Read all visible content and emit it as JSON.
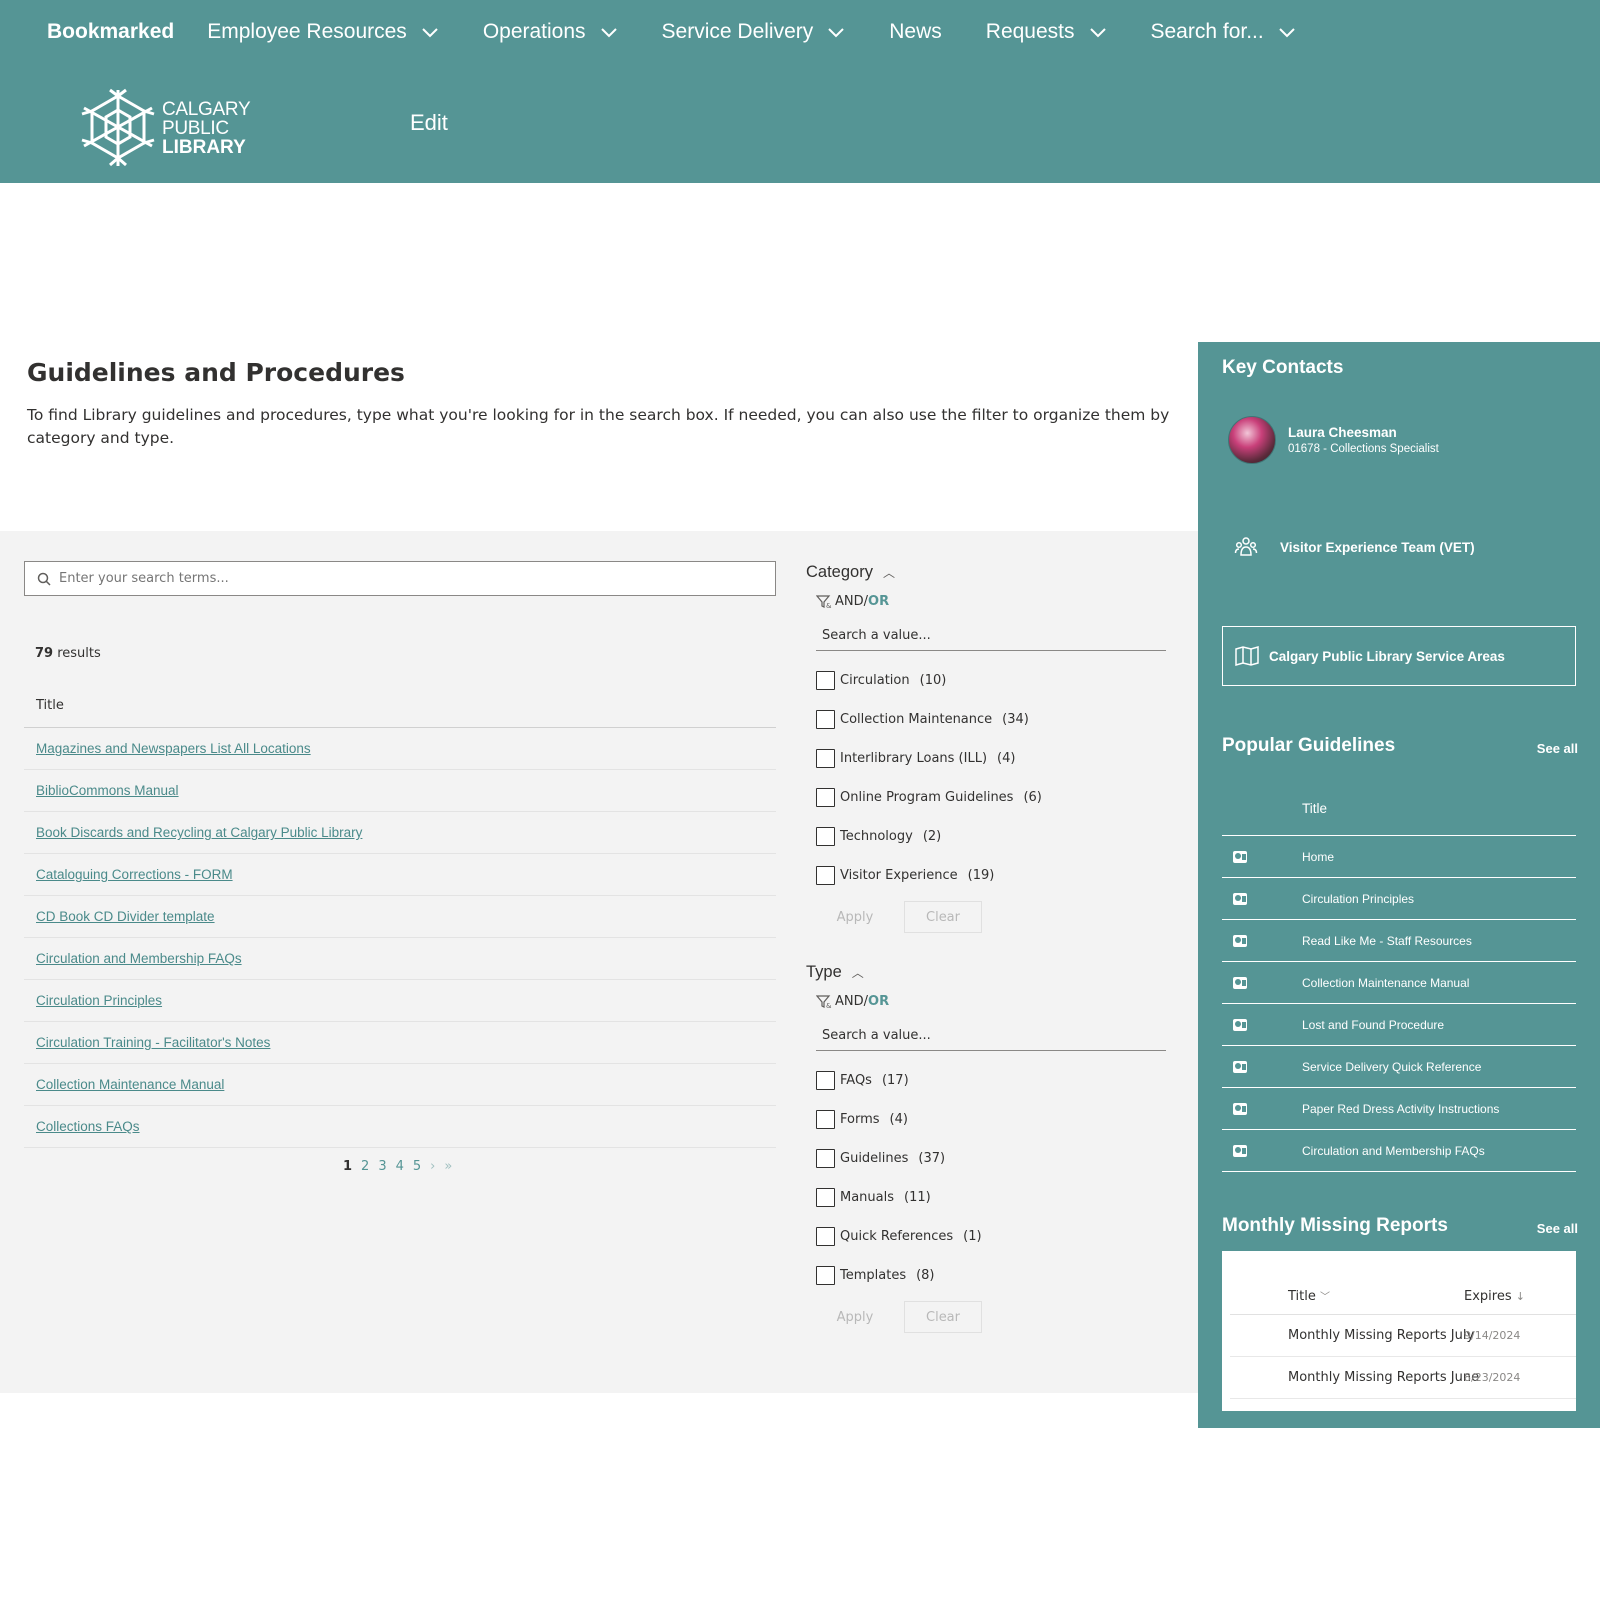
{
  "nav": {
    "brand": "Bookmarked",
    "items": [
      {
        "label": "Employee Resources",
        "dropdown": true
      },
      {
        "label": "Operations",
        "dropdown": true
      },
      {
        "label": "Service Delivery",
        "dropdown": true
      },
      {
        "label": "News",
        "dropdown": false
      },
      {
        "label": "Requests",
        "dropdown": true
      },
      {
        "label": "Search for...",
        "dropdown": true
      }
    ]
  },
  "header": {
    "logo_line1": "CALGARY",
    "logo_line2": "PUBLIC",
    "logo_line3": "LIBRARY",
    "edit_label": "Edit"
  },
  "page": {
    "title": "Guidelines and Procedures",
    "description": "To find Library guidelines and procedures, type what you're looking for in the search box. If needed, you can also use the filter to organize them by category and type."
  },
  "search": {
    "placeholder": "Enter your search terms...",
    "results_count": "79",
    "results_label": " results",
    "column_title": "Title",
    "results": [
      "Magazines and Newspapers List All Locations",
      "BiblioCommons Manual",
      "Book Discards and Recycling at Calgary Public Library",
      "Cataloguing Corrections - FORM",
      "CD Book CD Divider template",
      "Circulation and Membership FAQs",
      "Circulation Principles",
      "Circulation Training - Facilitator's Notes",
      "Collection Maintenance Manual",
      "Collections FAQs"
    ],
    "pager": {
      "pages": [
        "1",
        "2",
        "3",
        "4",
        "5"
      ],
      "current": "1",
      "next": "›",
      "last": "»"
    }
  },
  "filters": {
    "andor_and": "AND/",
    "andor_or": "OR",
    "value_placeholder": "Search a value...",
    "apply_label": "Apply",
    "clear_label": "Clear",
    "category": {
      "title": "Category",
      "items": [
        {
          "label": "Circulation",
          "count": "(10)"
        },
        {
          "label": "Collection Maintenance",
          "count": "(34)"
        },
        {
          "label": "Interlibrary Loans (ILL)",
          "count": "(4)"
        },
        {
          "label": "Online Program Guidelines",
          "count": "(6)"
        },
        {
          "label": "Technology",
          "count": "(2)"
        },
        {
          "label": "Visitor Experience",
          "count": "(19)"
        }
      ]
    },
    "type": {
      "title": "Type",
      "items": [
        {
          "label": "FAQs",
          "count": "(17)"
        },
        {
          "label": "Forms",
          "count": "(4)"
        },
        {
          "label": "Guidelines",
          "count": "(37)"
        },
        {
          "label": "Manuals",
          "count": "(11)"
        },
        {
          "label": "Quick References",
          "count": "(1)"
        },
        {
          "label": "Templates",
          "count": "(8)"
        }
      ]
    }
  },
  "sidebar": {
    "key_contacts_title": "Key Contacts",
    "contact": {
      "name": "Laura Cheesman",
      "role": "01678 - Collections Specialist"
    },
    "team_label": "Visitor Experience Team (VET)",
    "service_areas_label": "Calgary Public Library Service Areas",
    "popular": {
      "title": "Popular Guidelines",
      "see_all": "See all",
      "column_title": "Title",
      "items": [
        "Home",
        "Circulation Principles",
        "Read Like Me - Staff Resources",
        "Collection Maintenance Manual",
        "Lost and Found Procedure",
        "Service Delivery Quick Reference",
        "Paper Red Dress Activity Instructions",
        "Circulation and Membership FAQs"
      ]
    },
    "missing": {
      "title": "Monthly Missing Reports",
      "see_all": "See all",
      "col_title": "Title",
      "col_expires": "Expires",
      "rows": [
        {
          "title": "Monthly Missing Reports July",
          "expires": "9/14/2024"
        },
        {
          "title": "Monthly Missing Reports June",
          "expires": "8/23/2024"
        }
      ]
    }
  },
  "colors": {
    "brand_teal": "#559595",
    "link_teal": "#4a8a8a",
    "panel_gray": "#f3f3f3"
  }
}
